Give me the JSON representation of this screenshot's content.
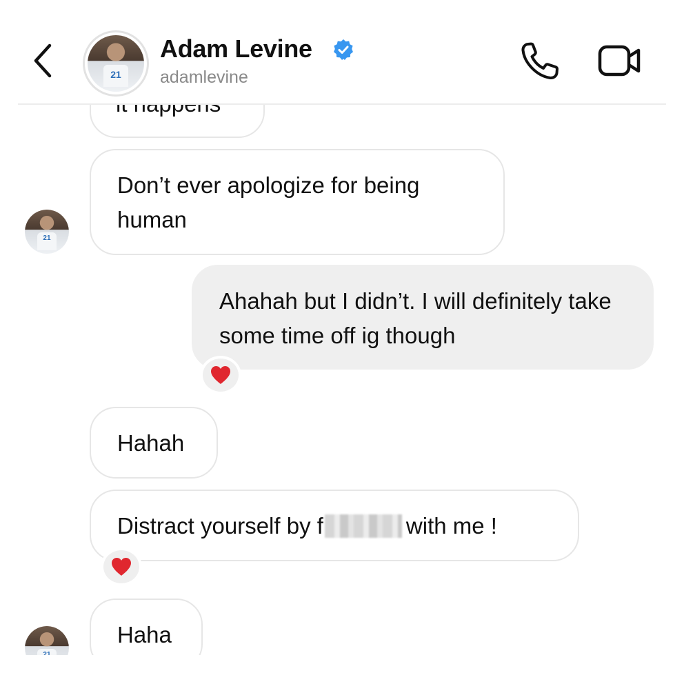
{
  "header": {
    "name": "Adam Levine",
    "handle": "adamlevine",
    "verified": true,
    "icons": {
      "back": "chevron-left-icon",
      "call": "phone-icon",
      "video": "video-camera-icon",
      "verified": "verified-badge-icon"
    }
  },
  "avatar": {
    "jersey_number": "21"
  },
  "messages": [
    {
      "side": "incoming",
      "text": "it happens"
    },
    {
      "side": "incoming",
      "text": "Don’t ever apologize for being human"
    },
    {
      "side": "outgoing",
      "text": "Ahahah but I didn’t. I will definitely take some time off ig though",
      "reaction": "❤️"
    },
    {
      "side": "incoming",
      "text": "Hahah"
    },
    {
      "side": "incoming",
      "text_before": "Distract yourself by f",
      "text_after": "with me !",
      "reaction": "❤️"
    },
    {
      "side": "incoming",
      "text": "Haha"
    }
  ],
  "colors": {
    "incoming_bubble": "#ffffff",
    "outgoing_bubble": "#efefef",
    "verified_blue": "#3897f0",
    "heart_red": "#e0272f"
  }
}
